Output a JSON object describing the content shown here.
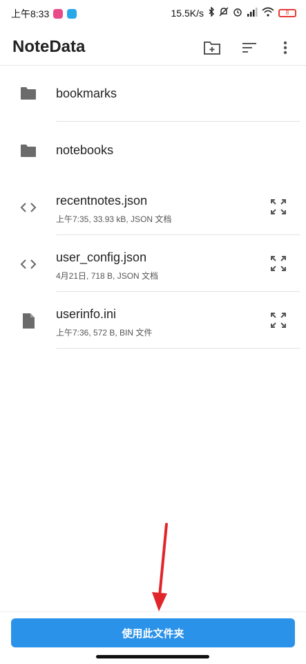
{
  "status_bar": {
    "time": "上午8:33",
    "network_speed": "15.5K/s",
    "battery_level": "8",
    "colors": {
      "battery": "#e53935",
      "app_icon_1": "#e94a8a",
      "app_icon_2": "#2aa7e8"
    }
  },
  "app_bar": {
    "title": "NoteData",
    "icons": [
      "new-folder-icon",
      "sort-icon",
      "more-vert-icon"
    ]
  },
  "files": [
    {
      "name": "bookmarks",
      "type": "folder",
      "meta": ""
    },
    {
      "name": "notebooks",
      "type": "folder",
      "meta": ""
    },
    {
      "name": "recentnotes.json",
      "type": "code",
      "meta": "上午7:35, 33.93 kB, JSON 文档"
    },
    {
      "name": "user_config.json",
      "type": "code",
      "meta": "4月21日, 718 B, JSON 文档"
    },
    {
      "name": "userinfo.ini",
      "type": "file",
      "meta": "上午7:36, 572 B, BIN 文件"
    }
  ],
  "action_button": {
    "label": "使用此文件夹",
    "color": "#2b92ea"
  },
  "annotation": {
    "arrow_color": "#e0262b"
  }
}
